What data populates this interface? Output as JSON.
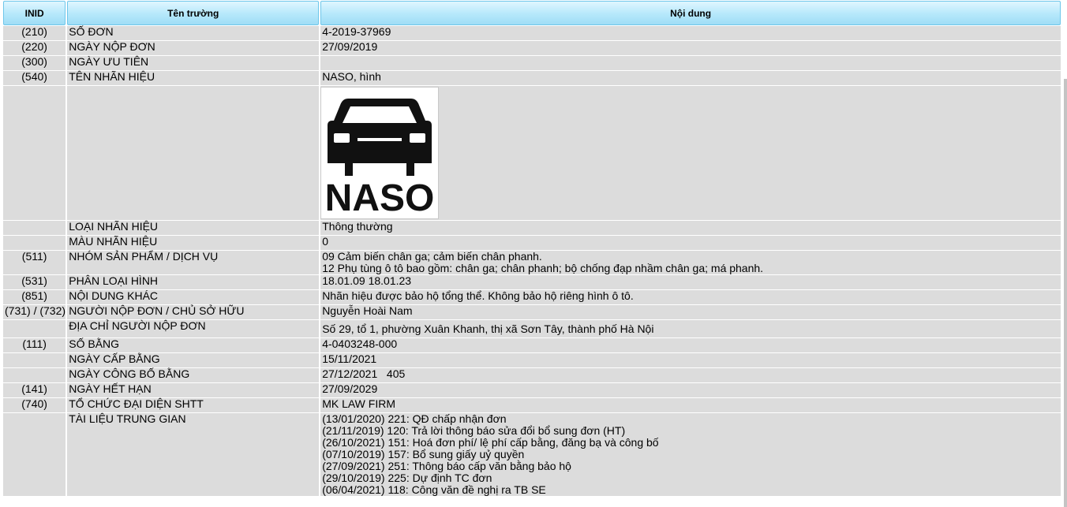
{
  "header": {
    "inid": "INID",
    "field": "Tên trường",
    "content": "Nội dung"
  },
  "rows": [
    {
      "inid": "(210)",
      "field": "SỐ ĐƠN",
      "value": "4-2019-37969"
    },
    {
      "inid": "(220)",
      "field": "NGÀY NỘP ĐƠN",
      "value": "27/09/2019"
    },
    {
      "inid": "(300)",
      "field": "NGÀY ƯU TIÊN",
      "value": ""
    },
    {
      "inid": "(540)",
      "field": "TÊN NHÃN HIỆU",
      "value": "NASO, hình"
    },
    {
      "inid": "",
      "field": "LOẠI NHÃN HIỆU",
      "value": "Thông thường"
    },
    {
      "inid": "",
      "field": "MÀU NHÃN HIỆU",
      "value": "0"
    },
    {
      "inid": "(511)",
      "field": "NHÓM SẢN PHẨM / DỊCH VỤ",
      "lines": [
        "09 Cảm biến chân ga; cảm biến chân phanh.",
        "12 Phụ tùng ô tô bao gồm: chân ga; chân phanh; bộ chống đạp nhầm chân ga; má phanh."
      ]
    },
    {
      "inid": "(531)",
      "field": "PHÂN LOẠI HÌNH",
      "value": "18.01.09 18.01.23"
    },
    {
      "inid": "(851)",
      "field": "NỘI DUNG KHÁC",
      "value": "Nhãn hiệu được bảo hộ tổng thể. Không bảo hộ riêng hình ô tô."
    },
    {
      "inid": "(731) / (732)",
      "field": "NGƯỜI NỘP ĐƠN / CHỦ SỞ HỮU",
      "value": "Nguyễn Hoài Nam"
    },
    {
      "inid": "",
      "field": "ĐỊA CHỈ NGƯỜI NỘP ĐƠN",
      "value": "Số 29, tổ 1, phường Xuân Khanh, thị xã Sơn Tây, thành phố Hà Nội"
    },
    {
      "inid": "(111)",
      "field": "SỐ BẰNG",
      "value": "4-0403248-000"
    },
    {
      "inid": "",
      "field": "NGÀY CẤP BẰNG",
      "value": "15/11/2021"
    },
    {
      "inid": "",
      "field": "NGÀY CÔNG BỐ BẰNG",
      "value": "27/12/2021   405"
    },
    {
      "inid": "(141)",
      "field": "NGÀY HẾT HẠN",
      "value": "27/09/2029"
    },
    {
      "inid": "(740)",
      "field": "TỔ CHỨC ĐẠI DIỆN SHTT",
      "value": "MK LAW FIRM"
    },
    {
      "inid": "",
      "field": "TÀI LIỆU TRUNG GIAN",
      "lines": [
        "(13/01/2020) 221: QĐ chấp nhận đơn",
        "(21/11/2019) 120: Trả lời thông báo sửa đổi bổ sung đơn (HT)",
        "(26/10/2021) 151: Hoá đơn phí/ lệ phí cấp bằng, đăng bạ và công bố",
        "(07/10/2019) 157: Bổ sung giấy uỷ quyền",
        "(27/09/2021) 251: Thông báo cấp văn bằng bảo hộ",
        "(29/10/2019) 225: Dự định TC đơn",
        "(06/04/2021) 118: Công văn đề nghị ra TB SE"
      ]
    }
  ],
  "mark_image": {
    "wordmark": "NASO",
    "icon": "car-front-icon"
  }
}
